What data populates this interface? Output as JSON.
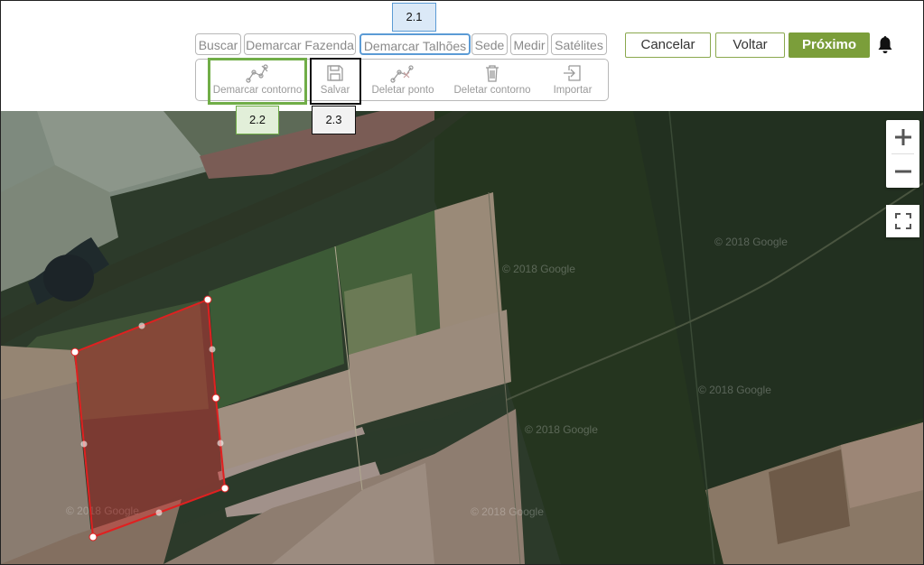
{
  "tabs": [
    "Buscar",
    "Demarcar Fazenda",
    "Demarcar Talhões",
    "Sede",
    "Medir",
    "Satélites"
  ],
  "actions": {
    "cancel": "Cancelar",
    "back": "Voltar",
    "next": "Próximo"
  },
  "tools": [
    "Demarcar contorno",
    "Salvar",
    "Deletar ponto",
    "Deletar contorno",
    "Importar"
  ],
  "callouts": {
    "tab_callout": "2.1",
    "contour_callout": "2.2",
    "save_callout": "2.3"
  },
  "map": {
    "watermark": "© 2018 Google"
  },
  "colors": {
    "brand_green": "#7b9e3a",
    "callout_blue": "#5b9bd5",
    "callout_green": "#70ad47",
    "polygon_red": "#e02020"
  }
}
